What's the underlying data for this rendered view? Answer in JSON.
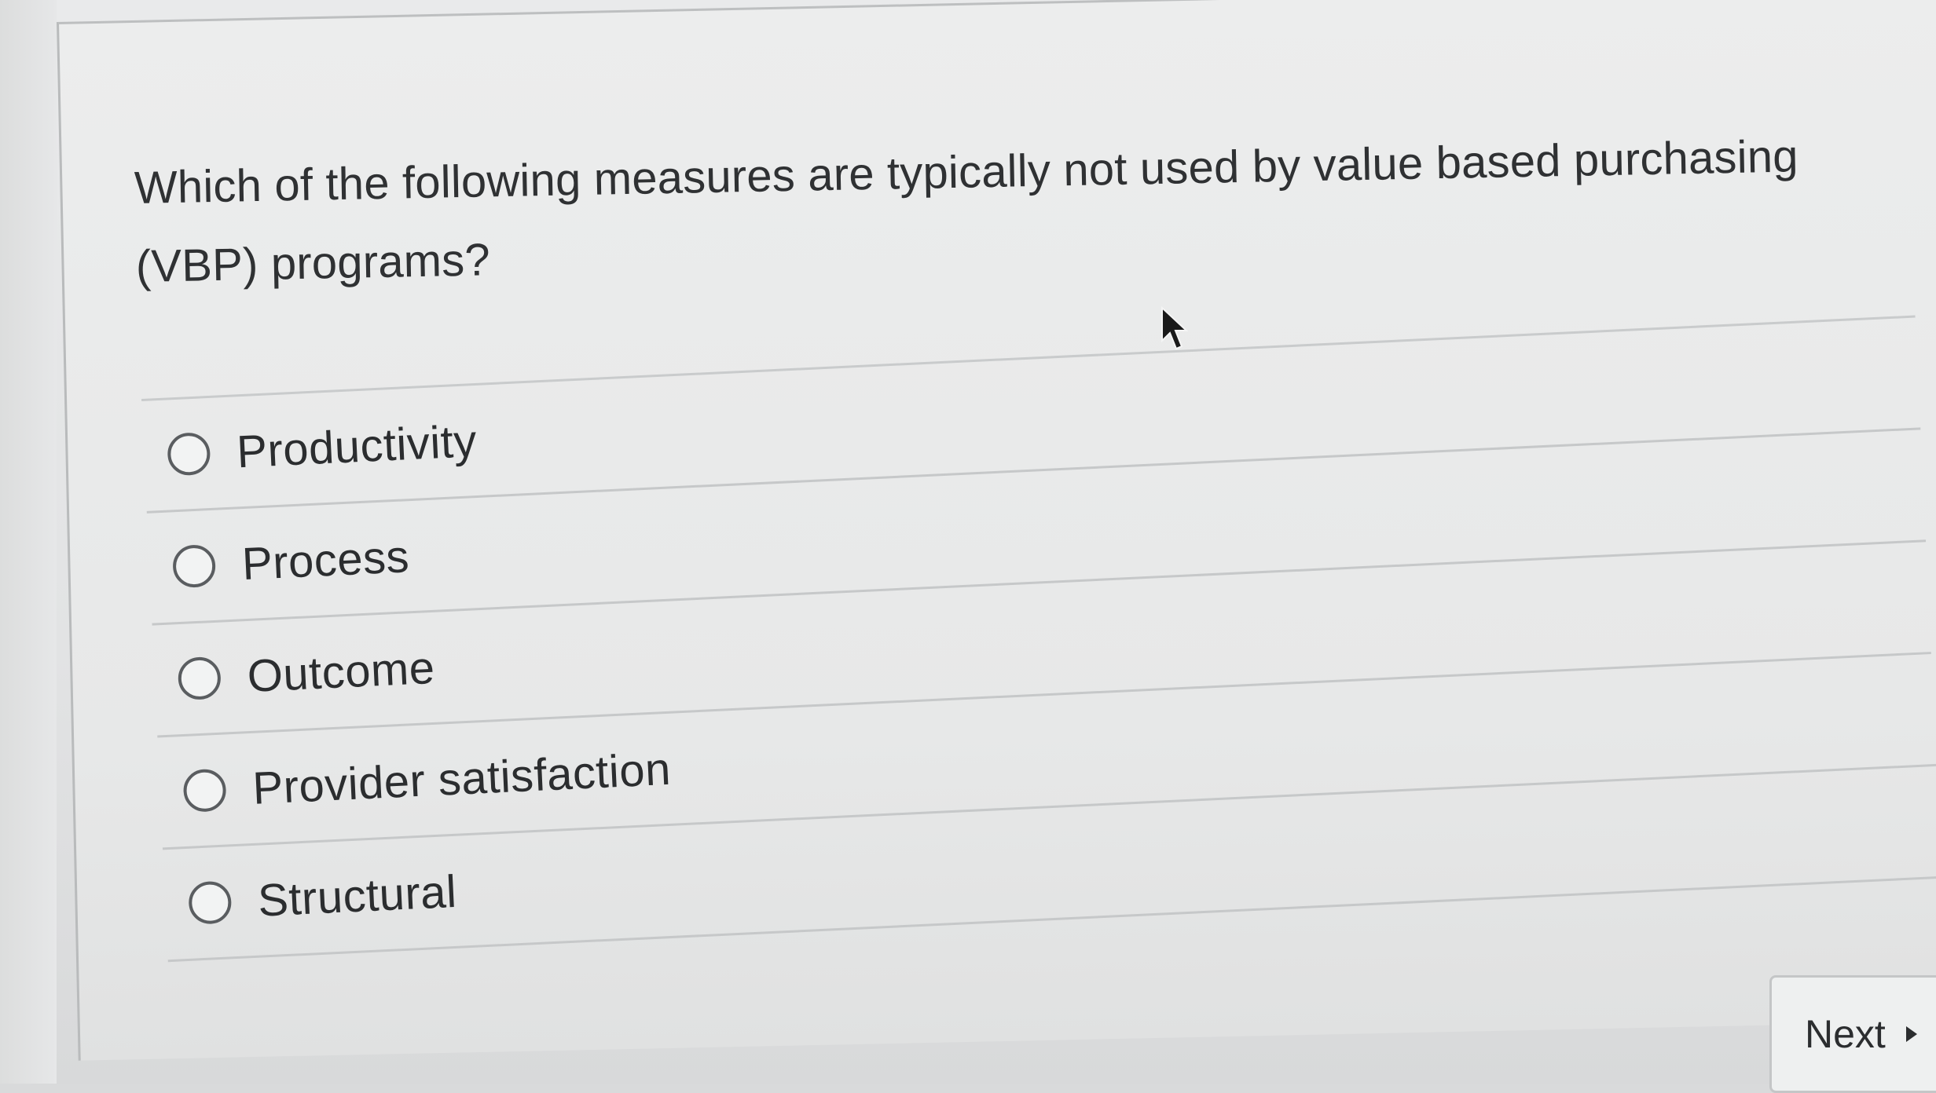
{
  "question": {
    "text": "Which of the following measures are typically not used by value based purchasing (VBP) programs?"
  },
  "options": [
    {
      "label": "Productivity",
      "selected": false
    },
    {
      "label": "Process",
      "selected": false
    },
    {
      "label": "Outcome",
      "selected": false
    },
    {
      "label": "Provider satisfaction",
      "selected": false
    },
    {
      "label": "Structural",
      "selected": false
    }
  ],
  "navigation": {
    "next_label": "Next",
    "next_icon": "caret-right-icon"
  },
  "colors": {
    "background": "#e7e8e8",
    "text": "#2f3133",
    "radio_border": "#5a5d60",
    "divider": "#c6c8c9"
  }
}
